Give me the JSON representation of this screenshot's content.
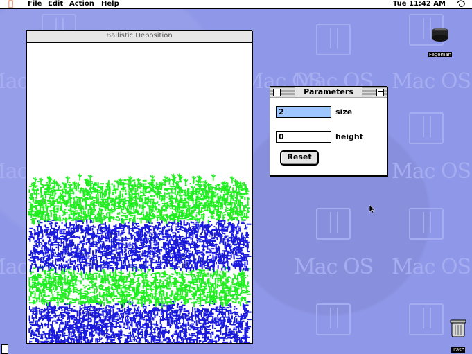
{
  "menubar": {
    "apple_icon": "apple-icon",
    "menus": [
      "File",
      "Edit",
      "Action",
      "Help"
    ],
    "clock": "Tue 11:42 AM",
    "app_icon": "application-icon"
  },
  "desktop": {
    "watermarks": [
      "Mac OS",
      "Mac OS",
      "Mac OS",
      "Mac OS",
      "Mac OS",
      "Mac OS",
      "Mac OS",
      "Mac OS",
      "Mac OS"
    ],
    "colors": {
      "background": "#8f97e8",
      "watermark": "#a6adf0"
    },
    "disk_label": "Fegeman",
    "trash_label": "Trash"
  },
  "main_window": {
    "title": "Ballistic Deposition",
    "colors": {
      "green": "#22ee22",
      "blue": "#1a1add"
    }
  },
  "parameters_window": {
    "title": "Parameters",
    "size_value": "2",
    "size_label": "size",
    "height_value": "0",
    "height_label": "height",
    "reset_label": "Reset"
  }
}
